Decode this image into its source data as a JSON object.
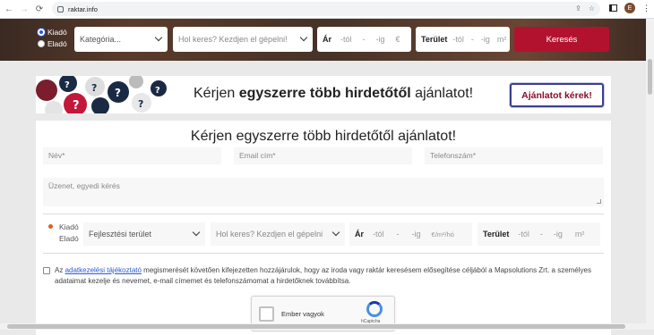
{
  "browser": {
    "url": "raktar.info",
    "profile_initial": "E"
  },
  "search": {
    "radio_rent": "Kiadó",
    "radio_sale": "Eladó",
    "category_placeholder": "Kategória...",
    "location_placeholder": "Hol keres? Kezdjen el gépelni!",
    "price_label": "Ár",
    "price_from": "-tól",
    "price_dash": "-",
    "price_to": "-ig",
    "price_unit": "€",
    "area_label": "Terület",
    "area_from": "-tól",
    "area_dash": "-",
    "area_to": "-ig",
    "area_unit": "m²",
    "button": "Keresés"
  },
  "banner": {
    "text_pre": "Kérjen ",
    "text_bold": "egyszerre több hirdetőtől",
    "text_post": " ajánlatot!",
    "button": "Ajánlatot kérek!"
  },
  "form": {
    "title": "Kérjen egyszerre több hirdetőtől ajánlatot!",
    "name_placeholder": "Név*",
    "email_placeholder": "Email cím*",
    "phone_placeholder": "Telefonszám*",
    "message_placeholder": "Üzenet, egyedi kérés",
    "radio_rent": "Kiadó",
    "radio_sale": "Eladó",
    "category_value": "Fejlesztési terület",
    "location_placeholder": "Hol keres? Kezdjen el gépelni",
    "price_label": "Ár",
    "price_from": "-tól",
    "price_dash": "-",
    "price_to": "-ig",
    "price_unit": "€/m²/hó",
    "area_label": "Terület",
    "area_from": "-tól",
    "area_dash": "-",
    "area_to": "-ig",
    "area_unit": "m²",
    "consent_pre": "Az ",
    "consent_link": "adatkezelési tájékoztató",
    "consent_post": " megismerését követően kifejezetten hozzájárulok, hogy az iroda vagy raktár keresésem elősegítése céljából a Mapsolutions Zrt. a személyes adataimat kezelje és nevemet, e-mail címemet és telefonszámomat a hirdetőknek továbbítsa.",
    "captcha_label": "Ember vagyok",
    "captcha_brand": "hCaptcha"
  },
  "colors": {
    "accent": "#b3122f",
    "link": "#2a5ad7"
  }
}
